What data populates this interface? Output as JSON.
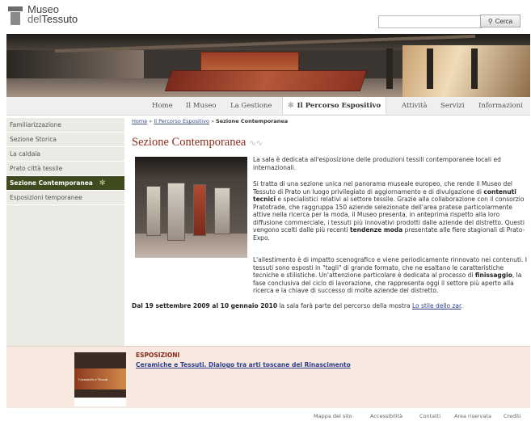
{
  "header": {
    "logo_line1": "Museo",
    "logo_line2_prefix": "del",
    "logo_line2_bold": "Tessuto",
    "search_placeholder": "",
    "search_button": "Cerca"
  },
  "topnav": [
    "Home",
    "Il Museo",
    "La Gestione",
    "Il Percorso Espositivo",
    "Attività",
    "Servizi",
    "Informazioni"
  ],
  "sidebar": [
    "Familiarizzazione",
    "Sezione Storica",
    "La caldaia",
    "Prato città tessile",
    "Sezione Contemporanea",
    "Esposizioni temporanee"
  ],
  "breadcrumb": {
    "home": "Home",
    "sep1": " » ",
    "section": "Il Percorso Espositivo",
    "sep2": " » ",
    "current": "Sezione Contemporanea"
  },
  "page_title": "Sezione Contemporanea",
  "body": {
    "p1": "La sala è dedicata all'esposizione delle produzioni tessili contemporanee locali ed internazionali.",
    "p2a": "Si tratta di una sezione unica nel panorama museale europeo, che rende il Museo del Tessuto di Prato un luogo privilegiato di aggiornamento e di divulgazione di ",
    "p2b": "contenuti tecnici",
    "p2c": " e specialistici relativi al settore tessile. Grazie alla collaborazione con il consorzio Pratotrade, che raggruppa 150 aziende selezionate dell'area pratese particolarmente attive nella ricerca per la moda, il Museo presenta, in anteprima rispetto alla loro diffusione commerciale, i tessuti più innovativi prodotti dalle aziende del distretto. Questi vengono scelti dalle più recenti ",
    "p2d": "tendenze moda",
    "p2e": " presentate alle fiere stagionali di Prato-Expo.",
    "p3a": "L'allestimento è di impatto scenografico e viene periodicamente rinnovato nei contenuti. I tessuti sono esposti in \"tagli\" di grande formato, che ne esaltano le caratteristiche tecniche e stilistiche. Un'attenzione particolare è dedicata al processo di ",
    "p3b": "finissaggio",
    "p3c": ", la fase conclusiva del ciclo di lavorazione, che rappresenta oggi il settore più aperto alla ricerca e la chiave di successo di molte aziende del distretto.",
    "p4a": "Dal 19 settembre 2009 al 10 gennaio 2010",
    "p4b": " la sala farà parte del percorso della mostra ",
    "p4link": "Lo stile dello zar",
    "p4end": "."
  },
  "expo": {
    "heading": "ESPOSIZIONI",
    "link": "Ceramiche e Tessuti. Dialogo tra arti toscane del Rinascimento",
    "image_caption": "Ceramiche e Tessuti"
  },
  "footer": [
    "Mappa del sito",
    "Accessibilità",
    "Contatti",
    "Area riservata",
    "Crediti"
  ]
}
